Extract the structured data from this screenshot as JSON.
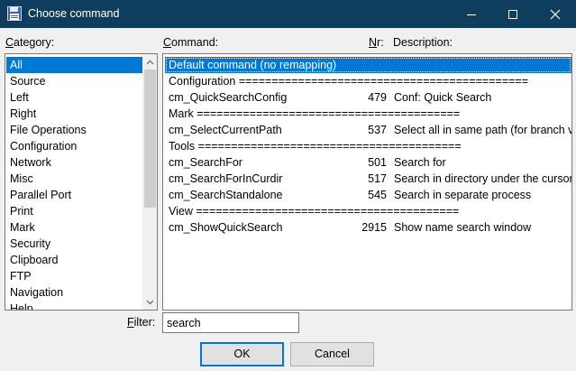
{
  "window": {
    "title": "Choose command",
    "app_icon": "floppy-disk-icon"
  },
  "labels": {
    "category": "Category:",
    "command": "Command:",
    "nr": "Nr:",
    "description": "Description:",
    "filter": "Filter:"
  },
  "categories": [
    {
      "label": "All",
      "selected": true
    },
    {
      "label": "Source"
    },
    {
      "label": "Left"
    },
    {
      "label": "Right"
    },
    {
      "label": "File Operations"
    },
    {
      "label": "Configuration"
    },
    {
      "label": "Network"
    },
    {
      "label": "Misc"
    },
    {
      "label": "Parallel Port"
    },
    {
      "label": "Print"
    },
    {
      "label": "Mark"
    },
    {
      "label": "Security"
    },
    {
      "label": "Clipboard"
    },
    {
      "label": "FTP"
    },
    {
      "label": "Navigation"
    },
    {
      "label": "Help"
    }
  ],
  "commands": [
    {
      "name": "Default command (no remapping)",
      "nr": "",
      "desc": "",
      "selected": true
    },
    {
      "name": "Configuration ============================================",
      "nr": "",
      "desc": ""
    },
    {
      "name": "cm_QuickSearchConfig",
      "nr": "479",
      "desc": "Conf: Quick Search"
    },
    {
      "name": "Mark ========================================",
      "nr": "",
      "desc": ""
    },
    {
      "name": "cm_SelectCurrentPath",
      "nr": "537",
      "desc": "Select all in same path (for branch view and search"
    },
    {
      "name": "Tools ========================================",
      "nr": "",
      "desc": ""
    },
    {
      "name": "cm_SearchFor",
      "nr": "501",
      "desc": "Search for"
    },
    {
      "name": "cm_SearchForInCurdir",
      "nr": "517",
      "desc": "Search in directory under the cursor"
    },
    {
      "name": "cm_SearchStandalone",
      "nr": "545",
      "desc": "Search in separate process"
    },
    {
      "name": "View ========================================",
      "nr": "",
      "desc": ""
    },
    {
      "name": "cm_ShowQuickSearch",
      "nr": "2915",
      "desc": "Show name search window"
    }
  ],
  "filter": {
    "value": "search"
  },
  "buttons": {
    "ok": "OK",
    "cancel": "Cancel"
  },
  "colors": {
    "titlebar": "#0f3d5d",
    "selection": "#0078d7"
  }
}
